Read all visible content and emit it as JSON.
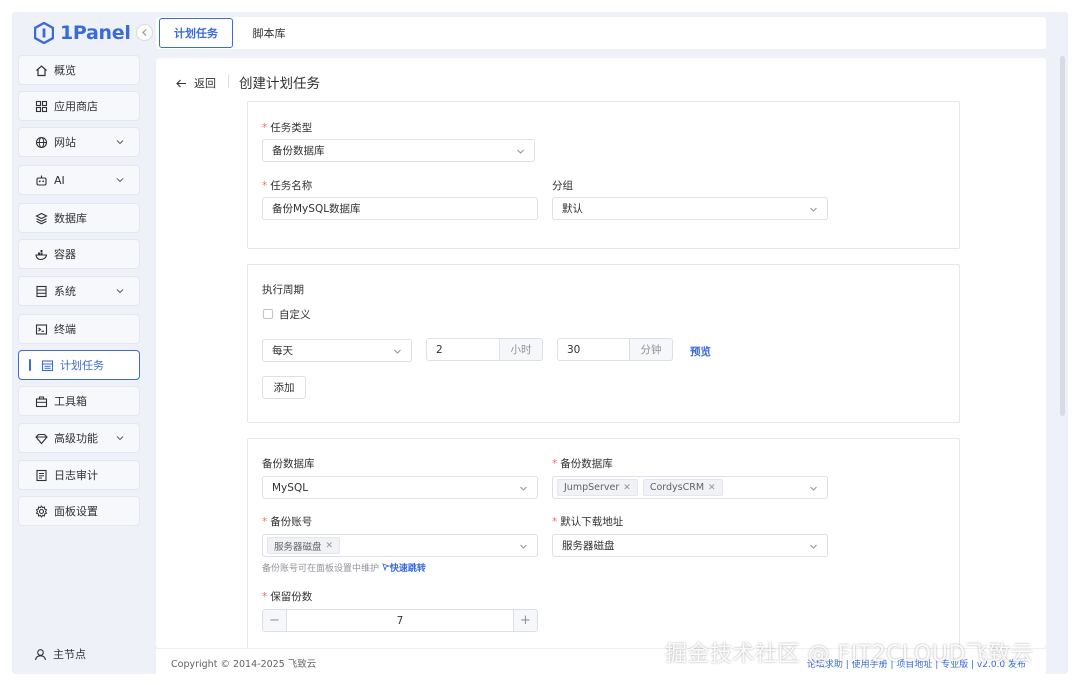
{
  "app": {
    "logo_text": "1Panel"
  },
  "sidebar": {
    "items": [
      {
        "label": "概览",
        "icon": "home-icon",
        "expandable": false
      },
      {
        "label": "应用商店",
        "icon": "apps-grid-icon",
        "expandable": false
      },
      {
        "label": "网站",
        "icon": "globe-icon",
        "expandable": true
      },
      {
        "label": "AI",
        "icon": "robot-icon",
        "expandable": true
      },
      {
        "label": "数据库",
        "icon": "layers-icon",
        "expandable": false
      },
      {
        "label": "容器",
        "icon": "docker-icon",
        "expandable": false
      },
      {
        "label": "系统",
        "icon": "server-icon",
        "expandable": true
      },
      {
        "label": "终端",
        "icon": "terminal-icon",
        "expandable": false
      },
      {
        "label": "计划任务",
        "icon": "calendar-icon",
        "expandable": false,
        "active": true
      },
      {
        "label": "工具箱",
        "icon": "toolbox-icon",
        "expandable": false
      },
      {
        "label": "高级功能",
        "icon": "diamond-icon",
        "expandable": true
      },
      {
        "label": "日志审计",
        "icon": "log-icon",
        "expandable": false
      },
      {
        "label": "面板设置",
        "icon": "gear-icon",
        "expandable": false
      }
    ],
    "node_label": "主节点"
  },
  "tabs": [
    {
      "label": "计划任务",
      "active": true
    },
    {
      "label": "脚本库",
      "active": false
    }
  ],
  "header": {
    "back_label": "返回",
    "title": "创建计划任务"
  },
  "section1": {
    "task_type_label": "任务类型",
    "task_type_value": "备份数据库",
    "task_name_label": "任务名称",
    "task_name_value": "备份MySQL数据库",
    "group_label": "分组",
    "group_value": "默认"
  },
  "section2": {
    "period_label": "执行周期",
    "custom_label": "自定义",
    "custom_checked": false,
    "frequency_value": "每天",
    "hour_value": "2",
    "hour_unit": "小时",
    "minute_value": "30",
    "minute_unit": "分钟",
    "preview_label": "预览",
    "add_label": "添加"
  },
  "section3": {
    "db_type_label": "备份数据库",
    "db_type_value": "MySQL",
    "db_select_label": "备份数据库",
    "db_tags": [
      "JumpServer",
      "CordysCRM"
    ],
    "account_label": "备份账号",
    "account_tags": [
      "服务器磁盘"
    ],
    "download_label": "默认下载地址",
    "download_value": "服务器磁盘",
    "hint_text": "备份账号可在面板设置中维护",
    "hint_link": "快速跳转",
    "retain_label": "保留份数",
    "retain_value": "7"
  },
  "footer": {
    "copyright": "Copyright © 2014-2025 飞致云",
    "links": "论坛求助 | 使用手册 | 项目地址 | 专业版 | v2.0.0 发布"
  },
  "watermark": "掘金技术社区 @ FIT2CLOUD飞致云",
  "colors": {
    "accent": "#3b6bd8",
    "required": "#f56c6c",
    "background": "#eef1f7"
  }
}
